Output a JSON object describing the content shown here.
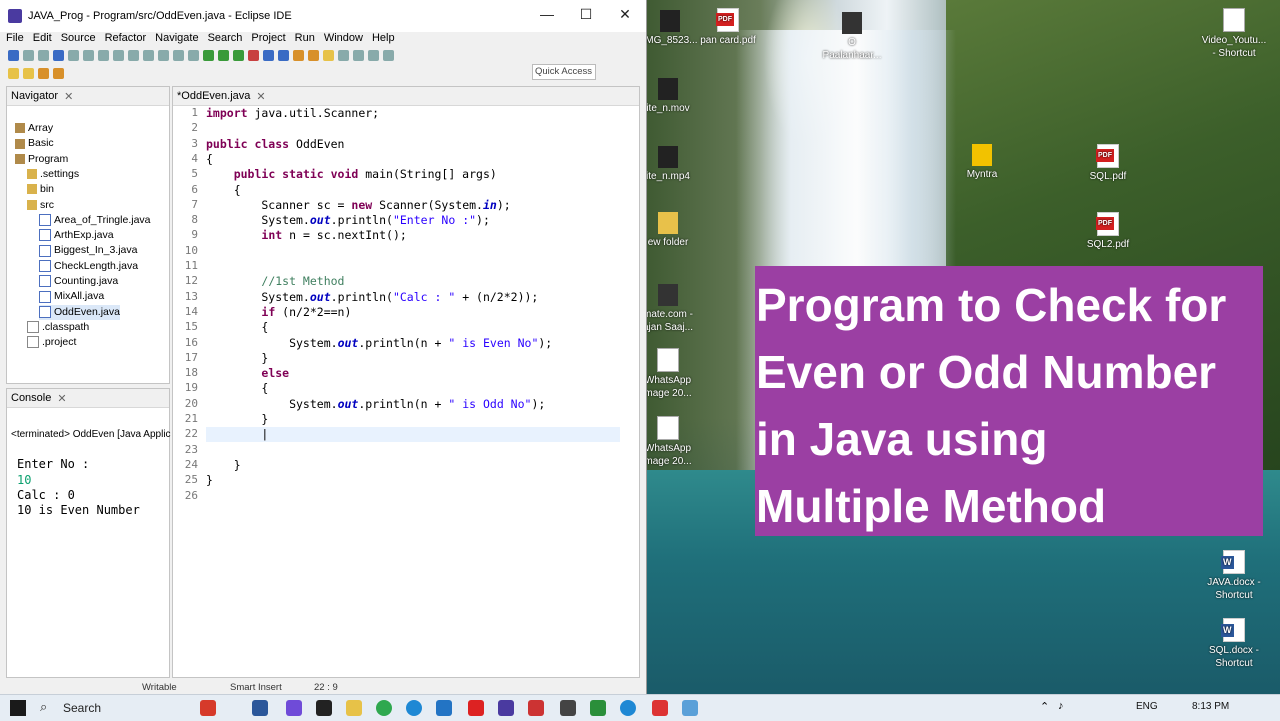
{
  "window": {
    "title": "JAVA_Prog - Program/src/OddEven.java - Eclipse IDE",
    "minimize": "—",
    "maximize": "☐",
    "close": "✕"
  },
  "menu": [
    "File",
    "Edit",
    "Source",
    "Refactor",
    "Navigate",
    "Search",
    "Project",
    "Run",
    "Window",
    "Help"
  ],
  "quick_access": "Quick Access",
  "navigator": {
    "tab": "Navigator",
    "items": [
      {
        "label": "Array",
        "kind": "project",
        "depth": 0
      },
      {
        "label": "Basic",
        "kind": "project",
        "depth": 0
      },
      {
        "label": "Program",
        "kind": "project",
        "depth": 0
      },
      {
        "label": ".settings",
        "kind": "folder",
        "depth": 1
      },
      {
        "label": "bin",
        "kind": "folder",
        "depth": 1
      },
      {
        "label": "src",
        "kind": "folder",
        "depth": 1
      },
      {
        "label": "Area_of_Tringle.java",
        "kind": "java",
        "depth": 2
      },
      {
        "label": "ArthExp.java",
        "kind": "java",
        "depth": 2
      },
      {
        "label": "Biggest_In_3.java",
        "kind": "java",
        "depth": 2
      },
      {
        "label": "CheckLength.java",
        "kind": "java",
        "depth": 2
      },
      {
        "label": "Counting.java",
        "kind": "java",
        "depth": 2
      },
      {
        "label": "MixAll.java",
        "kind": "java",
        "depth": 2
      },
      {
        "label": "OddEven.java",
        "kind": "java",
        "depth": 2,
        "selected": true
      },
      {
        "label": ".classpath",
        "kind": "xml",
        "depth": 1
      },
      {
        "label": ".project",
        "kind": "xml",
        "depth": 1
      }
    ]
  },
  "editor": {
    "tab": "*OddEven.java",
    "lines": [
      {
        "n": "1",
        "html": "<span class='kw'>import</span> java.util.Scanner;"
      },
      {
        "n": "2",
        "html": ""
      },
      {
        "n": "3",
        "html": "<span class='kw'>public class</span> OddEven"
      },
      {
        "n": "4",
        "html": "{"
      },
      {
        "n": "5",
        "html": "    <span class='kw'>public static void</span> main(String[] args)"
      },
      {
        "n": "6",
        "html": "    {"
      },
      {
        "n": "7",
        "html": "        Scanner sc = <span class='kw'>new</span> Scanner(System.<span class='it'>in</span>);"
      },
      {
        "n": "8",
        "html": "        System.<span class='it'>out</span>.println(<span class='str'>\"Enter No :\"</span>);"
      },
      {
        "n": "9",
        "html": "        <span class='kw'>int</span> n = sc.nextInt();"
      },
      {
        "n": "10",
        "html": ""
      },
      {
        "n": "11",
        "html": ""
      },
      {
        "n": "12",
        "html": "        <span class='cm'>//1st Method</span>"
      },
      {
        "n": "13",
        "html": "        System.<span class='it'>out</span>.println(<span class='str'>\"Calc : \"</span> + (n/2*2));"
      },
      {
        "n": "14",
        "html": "        <span class='kw'>if</span> (n/2*2==n)"
      },
      {
        "n": "15",
        "html": "        {"
      },
      {
        "n": "16",
        "html": "            System.<span class='it'>out</span>.println(n + <span class='str'>\" is Even No\"</span>);"
      },
      {
        "n": "17",
        "html": "        }"
      },
      {
        "n": "18",
        "html": "        <span class='kw'>else</span>"
      },
      {
        "n": "19",
        "html": "        {"
      },
      {
        "n": "20",
        "html": "            System.<span class='it'>out</span>.println(n + <span class='str'>\" is Odd No\"</span>);"
      },
      {
        "n": "21",
        "html": "        }"
      },
      {
        "n": "22",
        "html": "        |"
      },
      {
        "n": "23",
        "html": ""
      },
      {
        "n": "24",
        "html": "    }"
      },
      {
        "n": "25",
        "html": "}"
      },
      {
        "n": "26",
        "html": ""
      }
    ]
  },
  "console": {
    "tab": "Console",
    "terminated": "<terminated> OddEven [Java Applic",
    "output": [
      "Enter No :",
      "10",
      "Calc : 0",
      "10 is Even Number"
    ]
  },
  "statusbar": {
    "mode1": "Writable",
    "mode2": "Smart Insert",
    "pos": "22 : 9"
  },
  "banner": {
    "lines": [
      "Program to Check for",
      "Even or Odd Number",
      "in Java using",
      "Multiple Method"
    ],
    "color": "#9b3fa3"
  },
  "desktop_icons": [
    {
      "label": "IMG_8523...",
      "icon": "image"
    },
    {
      "label": "pan card.pdf",
      "icon": "pdf"
    },
    {
      "label": "O\nPaalanhaar...",
      "icon": "video"
    },
    {
      "label": "Video_Youtu...\n- Shortcut",
      "icon": "file"
    },
    {
      "label": "ite_n.mov",
      "icon": "video"
    },
    {
      "label": "ite_n.mp4",
      "icon": "video"
    },
    {
      "label": "Myntra",
      "icon": "app"
    },
    {
      "label": "SQL.pdf",
      "icon": "pdf"
    },
    {
      "label": "ew folder",
      "icon": "folder"
    },
    {
      "label": "SQL2.pdf",
      "icon": "pdf"
    },
    {
      "label": "mate.com -\najan Saaj...",
      "icon": "image"
    },
    {
      "label": "WhatsApp\nmage 20...",
      "icon": "image"
    },
    {
      "label": "WhatsApp\nmage 20...",
      "icon": "image"
    },
    {
      "label": "JAVA.docx -\nShortcut",
      "icon": "word"
    },
    {
      "label": "SQL.docx -\nShortcut",
      "icon": "word"
    }
  ],
  "taskbar": {
    "search": "Search",
    "lang": "ENG",
    "time": "8:13 PM"
  }
}
